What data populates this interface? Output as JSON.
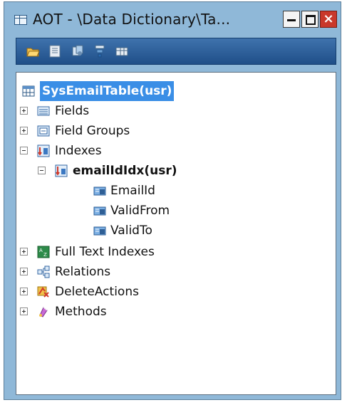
{
  "window": {
    "title": "AOT - \\Data Dictionary\\Ta...",
    "close_glyph": "×"
  },
  "toolbar": {
    "icons": [
      "open-folder-icon",
      "properties-icon",
      "compile-icon",
      "filter-icon",
      "grid-icon"
    ]
  },
  "tree": {
    "root": {
      "label": "SysEmailTable(usr)",
      "icon": "table-icon",
      "selected": true
    },
    "fields": {
      "label": "Fields",
      "icon": "fields-icon",
      "expander": "+"
    },
    "field_groups": {
      "label": "Field Groups",
      "icon": "field-groups-icon",
      "expander": "+"
    },
    "indexes": {
      "label": "Indexes",
      "icon": "indexes-icon",
      "expander": "-"
    },
    "index": {
      "label": "emailIdIdx(usr)",
      "icon": "index-icon",
      "expander": "-"
    },
    "index_fields": [
      {
        "label": "EmailId",
        "icon": "string-field-icon"
      },
      {
        "label": "ValidFrom",
        "icon": "utc-datetime-field-icon"
      },
      {
        "label": "ValidTo",
        "icon": "utc-datetime-field-icon"
      }
    ],
    "full_text_indexes": {
      "label": "Full Text Indexes",
      "icon": "full-text-index-icon",
      "expander": "+"
    },
    "relations": {
      "label": "Relations",
      "icon": "relations-icon",
      "expander": "+"
    },
    "delete_actions": {
      "label": "DeleteActions",
      "icon": "delete-actions-icon",
      "expander": "+"
    },
    "methods": {
      "label": "Methods",
      "icon": "methods-icon",
      "expander": "+"
    }
  }
}
